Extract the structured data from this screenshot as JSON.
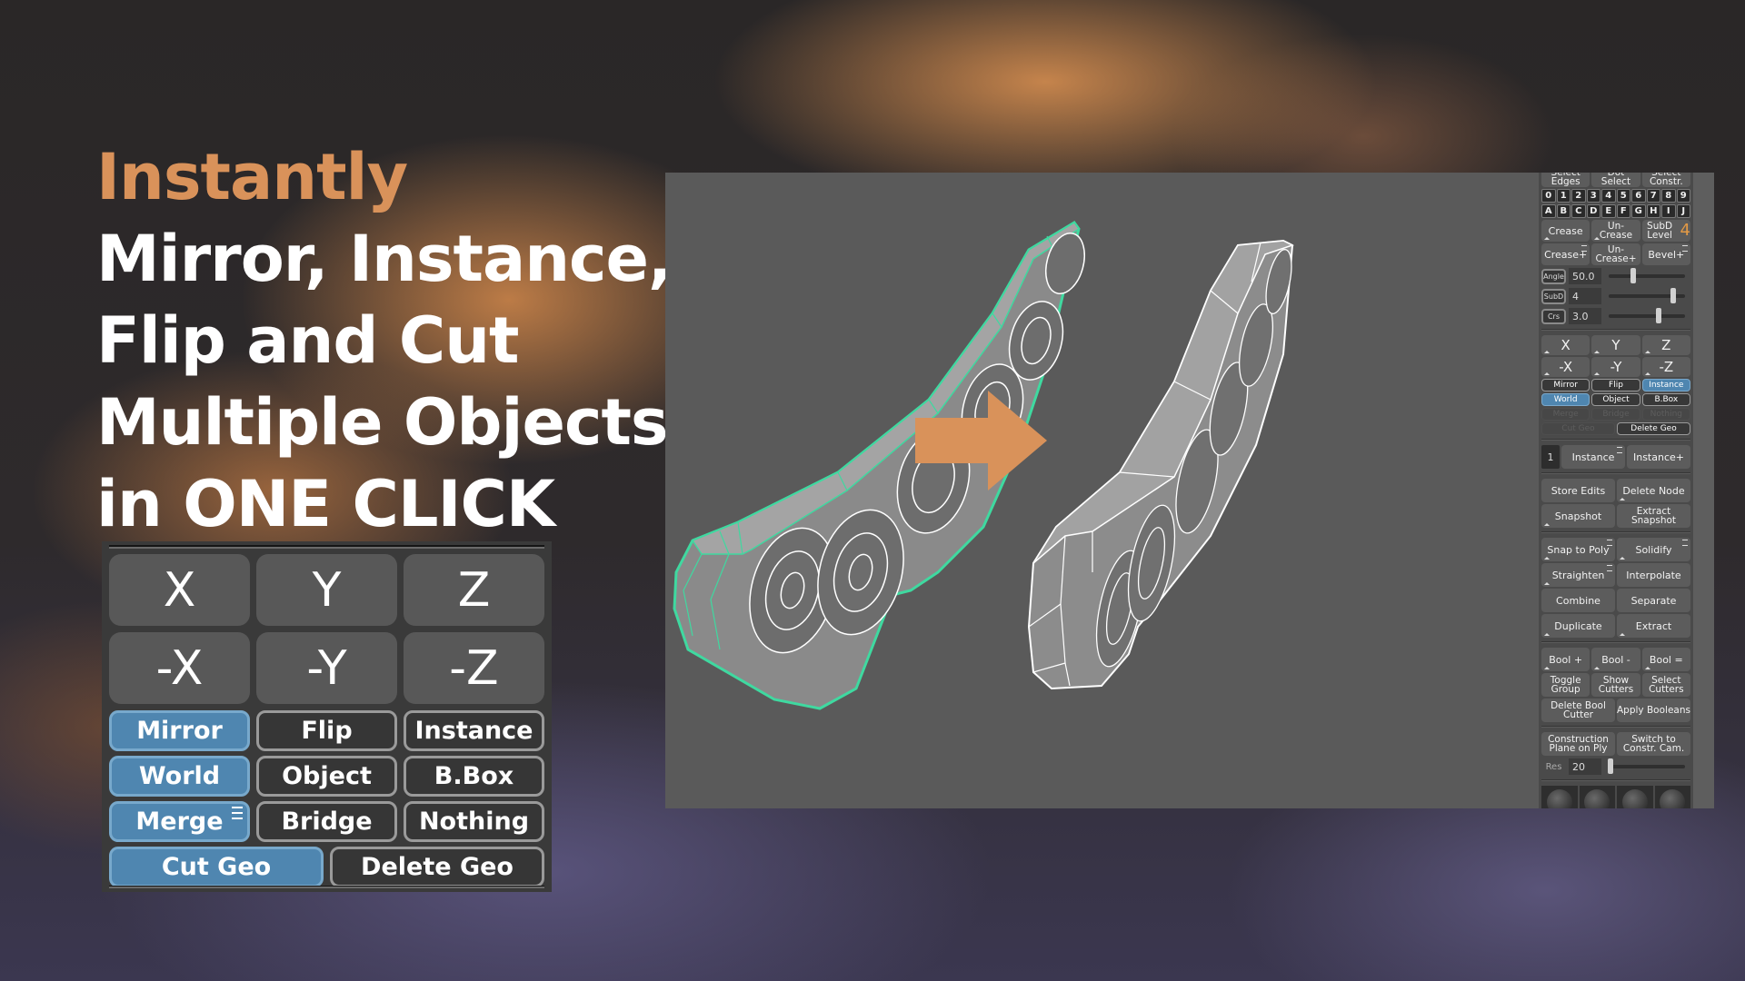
{
  "headline": {
    "accent": "Instantly",
    "lines": [
      "Mirror, Instance,",
      "Flip and Cut",
      "Multiple Objects",
      "in ONE CLICK"
    ]
  },
  "colors": {
    "accent": "#d9925a",
    "active_blue": "#4f86b0",
    "selection_green": "#3fd9a0",
    "arrow_orange": "#d9925a"
  },
  "mirror_panel": {
    "axes": [
      "X",
      "Y",
      "Z"
    ],
    "neg_axes": [
      "-X",
      "-Y",
      "-Z"
    ],
    "mode_row": [
      {
        "label": "Mirror",
        "active": true
      },
      {
        "label": "Flip",
        "active": false
      },
      {
        "label": "Instance",
        "active": false
      }
    ],
    "space_row": [
      {
        "label": "World",
        "active": true
      },
      {
        "label": "Object",
        "active": false
      },
      {
        "label": "B.Box",
        "active": false
      }
    ],
    "merge_row": [
      {
        "label": "Merge",
        "active": true,
        "has_menu": true
      },
      {
        "label": "Bridge",
        "active": false
      },
      {
        "label": "Nothing",
        "active": false
      }
    ],
    "cut_row": [
      {
        "label": "Cut Geo",
        "active": true
      },
      {
        "label": "Delete Geo",
        "active": false
      }
    ]
  },
  "viewport": {
    "arrow_icon": "right-arrow"
  },
  "side_panel": {
    "top_row": [
      "Select Edges",
      "Dot Select",
      "Select Constr."
    ],
    "number_keys": [
      "0",
      "1",
      "2",
      "3",
      "4",
      "5",
      "6",
      "7",
      "8",
      "9"
    ],
    "letter_keys": [
      "A",
      "B",
      "C",
      "D",
      "E",
      "F",
      "G",
      "H",
      "I",
      "J"
    ],
    "crease_row": [
      "Crease",
      "Un-Crease",
      "SubD Level"
    ],
    "subd_level": "4",
    "crease_plus_row": [
      "Crease+",
      "Un-Crease+",
      "Bevel+"
    ],
    "sliders": [
      {
        "label": "Angle",
        "value": "50.0",
        "fraction": 0.32
      },
      {
        "label": "SubD",
        "value": "4",
        "fraction": 0.85
      },
      {
        "label": "Crs",
        "value": "3.0",
        "fraction": 0.66
      }
    ],
    "axes": [
      "X",
      "Y",
      "Z"
    ],
    "neg_axes": [
      "-X",
      "-Y",
      "-Z"
    ],
    "mode_row": [
      {
        "label": "Mirror",
        "state": "off"
      },
      {
        "label": "Flip",
        "state": "off"
      },
      {
        "label": "Instance",
        "state": "on"
      }
    ],
    "space_row": [
      {
        "label": "World",
        "state": "on"
      },
      {
        "label": "Object",
        "state": "off"
      },
      {
        "label": "B.Box",
        "state": "off"
      }
    ],
    "merge_row": [
      {
        "label": "Merge",
        "state": "dim"
      },
      {
        "label": "Bridge",
        "state": "dim"
      },
      {
        "label": "Nothing",
        "state": "dim"
      }
    ],
    "cut_row": [
      {
        "label": "Cut Geo",
        "state": "dim"
      },
      {
        "label": "Delete Geo",
        "state": "off"
      }
    ],
    "instance_count": "1",
    "instance_row": [
      "Instance",
      "Instance+"
    ],
    "edits_row": [
      "Store Edits",
      "Delete Node"
    ],
    "snapshot_row": [
      "Snapshot",
      "Extract Snapshot"
    ],
    "snap_row": [
      "Snap to Poly",
      "Solidify"
    ],
    "straighten_row": [
      "Straighten",
      "Interpolate"
    ],
    "combine_row": [
      "Combine",
      "Separate"
    ],
    "duplicate_row": [
      "Duplicate",
      "Extract"
    ],
    "bool_row": [
      "Bool +",
      "Bool -",
      "Bool ="
    ],
    "cutters_row": [
      "Toggle Group",
      "Show Cutters",
      "Select Cutters"
    ],
    "apply_row": [
      "Delete Bool Cutter",
      "Apply Booleans"
    ],
    "constr_row": [
      "Construction Plane on Ply",
      "Switch to Constr. Cam."
    ],
    "res": {
      "label": "Res",
      "value": "20",
      "fraction": 0.02
    },
    "material_spheres": 4
  }
}
